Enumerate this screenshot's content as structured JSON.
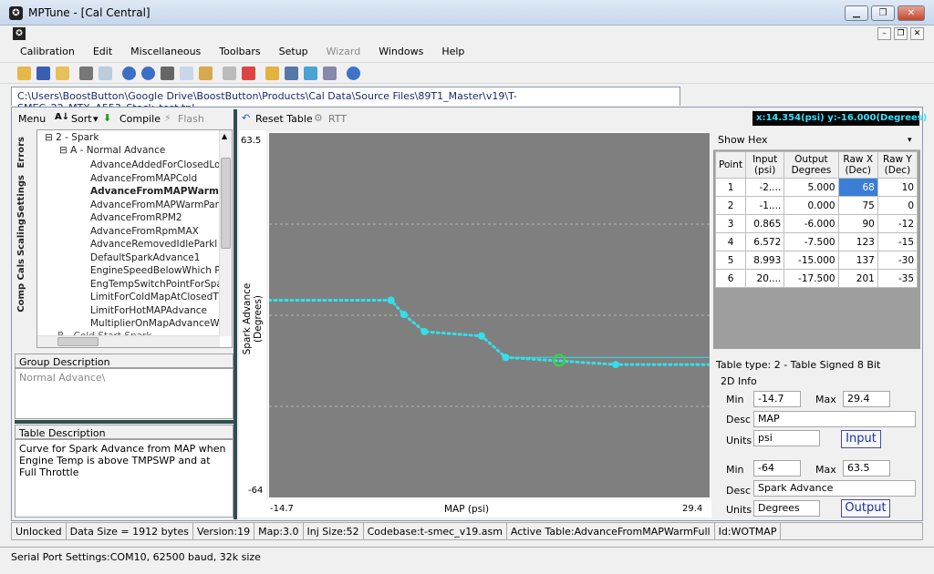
{
  "window": {
    "title": "MPTune - [Cal Central]",
    "app_icon": "✪"
  },
  "menu": [
    {
      "label": "Calibration"
    },
    {
      "label": "Edit"
    },
    {
      "label": "Miscellaneous"
    },
    {
      "label": "Toolbars"
    },
    {
      "label": "Setup"
    },
    {
      "label": "Wizard",
      "disabled": true
    },
    {
      "label": "Windows"
    },
    {
      "label": "Help"
    }
  ],
  "file_tab": "C:\\Users\\BoostButton\\Google Drive\\BoostButton\\Products\\Cal Data\\Source Files\\89T1_Master\\v19\\T-SMEC_22_MTX_A553_Stock_test.tpl",
  "left_toolbar": {
    "menu": "Menu",
    "sort": "Sort",
    "compile": "Compile",
    "flash": "Flash"
  },
  "vertical_tabs": [
    "Errors",
    "Settings",
    "Scaling",
    "Comp Cals"
  ],
  "tree": {
    "group": "2 - Spark",
    "subgroup": "A - Normal Advance",
    "items": [
      "AdvanceAddedForClosedLo",
      "AdvanceFromMAPCold",
      "AdvanceFromMAPWarmFull",
      "AdvanceFromMAPWarmPar",
      "AdvanceFromRPM2",
      "AdvanceFromRpmMAX",
      "AdvanceRemovedIdleParkl",
      "DefaultSparkAdvance1",
      "EngineSpeedBelowWhich P",
      "EngTempSwitchPointForSpa",
      "LimitForColdMapAtClosedT",
      "LimitForHotMAPAdvance",
      "MultiplierOnMapAdvanceWl"
    ],
    "selected_index": 2,
    "next_group": "B - Cold Start Spark"
  },
  "group_description": {
    "header": "Group Description",
    "text": "Normal Advance\\"
  },
  "table_description": {
    "header": "Table Description",
    "text": "Curve for Spark Advance from MAP when Engine Temp is above TMPSWP and at Full Throttle"
  },
  "chart_toolbar": {
    "reset": "Reset Table",
    "rtt": "RTT"
  },
  "coord_readout": "x:14.354(psi) y:-16.000(Degrees)",
  "chart_data": {
    "type": "line",
    "x": [
      -2.5,
      -1.2,
      0.865,
      6.572,
      8.993,
      20.0
    ],
    "values": [
      5.0,
      0.0,
      -6.0,
      -7.5,
      -15.0,
      -17.5
    ],
    "ylabel": "Spark Advance (Degrees)",
    "xlabel": "MAP (psi)",
    "xlim": [
      -14.7,
      29.4
    ],
    "ylim": [
      -64,
      63.5
    ],
    "x_tick_labels": [
      "-14.7",
      "29.4"
    ],
    "y_tick_labels": [
      "63.5",
      "-64"
    ],
    "cursor": {
      "x": 14.354,
      "y": -16.0
    },
    "line_color": "#33e0e8",
    "plot_bg": "#7f7f7f"
  },
  "table": {
    "show_hex": "Show Hex",
    "headers": [
      "Point",
      "Input (psi)",
      "Output Degrees",
      "Raw X (Dec)",
      "Raw Y (Dec)"
    ],
    "rows": [
      [
        "1",
        "-2....",
        "5.000",
        "68",
        "10"
      ],
      [
        "2",
        "-1....",
        "0.000",
        "75",
        "0"
      ],
      [
        "3",
        "0.865",
        "-6.000",
        "90",
        "-12"
      ],
      [
        "4",
        "6.572",
        "-7.500",
        "123",
        "-15"
      ],
      [
        "5",
        "8.993",
        "-15.000",
        "137",
        "-30"
      ],
      [
        "6",
        "20....",
        "-17.500",
        "201",
        "-35"
      ]
    ]
  },
  "info": {
    "table_type": "Table type: 2 - Table Signed 8 Bit",
    "section": "2D Info",
    "min_label": "Min",
    "max_label": "Max",
    "desc_label": "Desc",
    "units_label": "Units",
    "input": {
      "min": "-14.7",
      "max": "29.4",
      "desc": "MAP",
      "units": "psi",
      "button": "Input"
    },
    "output": {
      "min": "-64",
      "max": "63.5",
      "desc": "Spark Advance",
      "units": "Degrees",
      "button": "Output"
    }
  },
  "status": [
    "Unlocked",
    "Data Size = 1912 bytes",
    "Version:19",
    "Map:3.0",
    "Inj Size:52",
    "Codebase:t-smec_v19.asm",
    "Active Table:AdvanceFromMAPWarmFull",
    "Id:WOTMAP"
  ],
  "serial": "Serial Port Settings:COM10, 62500 baud, 32k size"
}
